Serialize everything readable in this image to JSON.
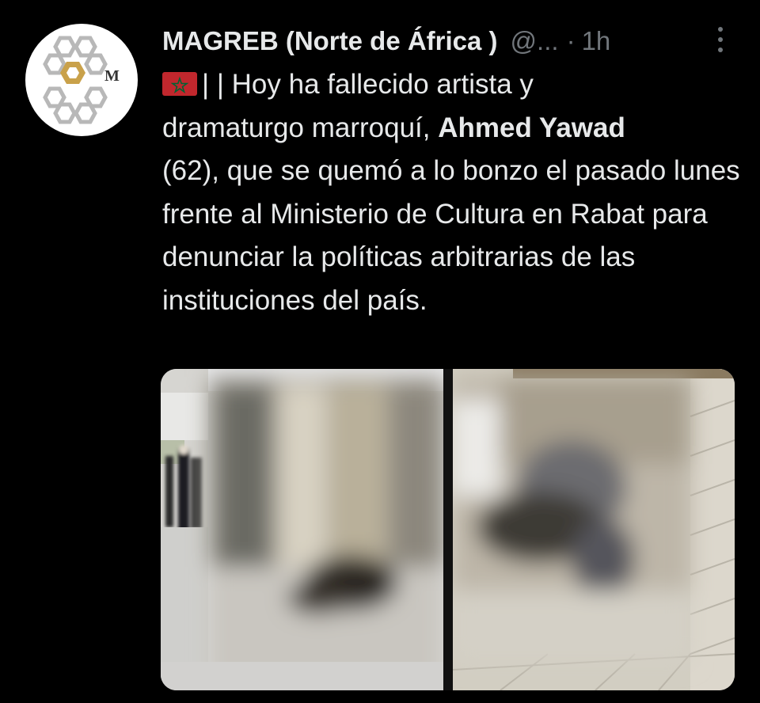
{
  "tweet": {
    "author_name": "MAGREB (Norte de África )",
    "handle": "@...",
    "separator": "·",
    "time": "1h",
    "avatar_letter": "M",
    "flag": "morocco-flag-emoji",
    "text_line_1": "| | Hoy ha fallecido artista y",
    "text_line_2_pre": "dramaturgo marroquí, ",
    "text_bold_name": "Ahmed Yawad",
    "text_rest": "(62), que se quemó a lo bonzo el pasado lunes frente al Ministerio de Cultura en Rabat para denunciar la políticas arbitrarias de las instituciones del país."
  },
  "icons": {
    "more": "more-vertical-icon"
  },
  "colors": {
    "background": "#000000",
    "text": "#e7e9ea",
    "muted": "#71767b",
    "flag_red": "#c1272d",
    "flag_green": "#006233",
    "avatar_gold": "#c9a14a"
  },
  "media": {
    "count": 2,
    "images": [
      {
        "description_icon": "blurred-photo-1"
      },
      {
        "description_icon": "blurred-photo-2"
      }
    ]
  }
}
